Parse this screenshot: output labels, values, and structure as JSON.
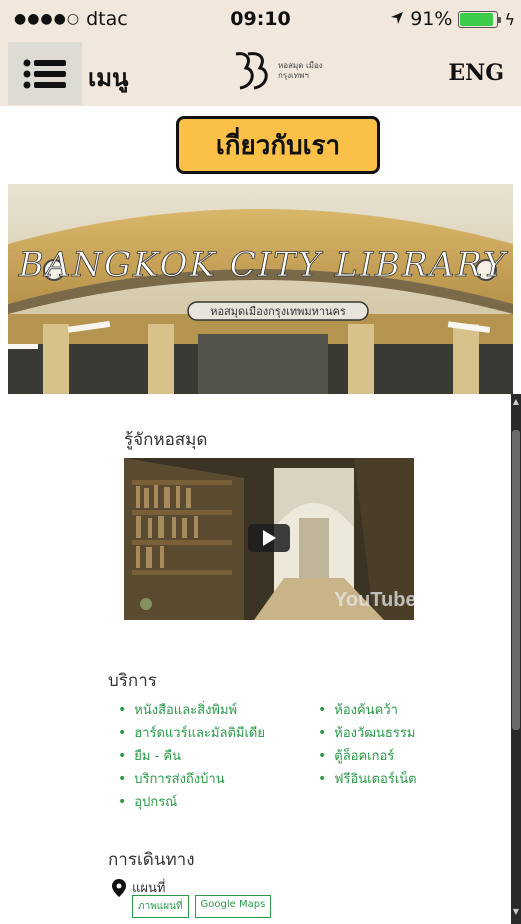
{
  "status_bar": {
    "signal": "●●●●○",
    "carrier": "dtac",
    "time": "09:10",
    "battery_percent": "91%",
    "battery_level": 0.91
  },
  "header": {
    "menu_label": "เมนู",
    "logo_text": "หอสมุด เมือง กรุงเทพฯ",
    "lang_label": "ENG"
  },
  "about_button": "เกี่ยวกับเรา",
  "hero": {
    "sign_text": "BANGKOK CITY LIBRARY",
    "plaque_text": "หอสมุดเมืองกรุงเทพมหานคร"
  },
  "about_section": {
    "title": "รู้จักหอสมุด",
    "video_brand": "YouTube"
  },
  "services": {
    "title": "บริการ",
    "left": [
      "หนังสือและสิ่งพิมพ์",
      "ฮาร์ดแวร์และมัลติมีเดีย",
      "ยืม - คืน",
      "บริการส่งถึงบ้าน",
      "อุปกรณ์"
    ],
    "right": [
      "ห้องค้นคว้า",
      "ห้องวัฒนธรรม",
      "ตู้ล็อคเกอร์",
      "ฟรีอินเตอร์เน็ต"
    ]
  },
  "travel": {
    "title": "การเดินทาง",
    "map_label": "แผนที่",
    "buttons": [
      "ภาพแผนที่",
      "Google Maps"
    ]
  },
  "colors": {
    "header_bg": "#f2e7dc",
    "accent_yellow": "#fbc048",
    "link_green": "#2a9a4a"
  }
}
